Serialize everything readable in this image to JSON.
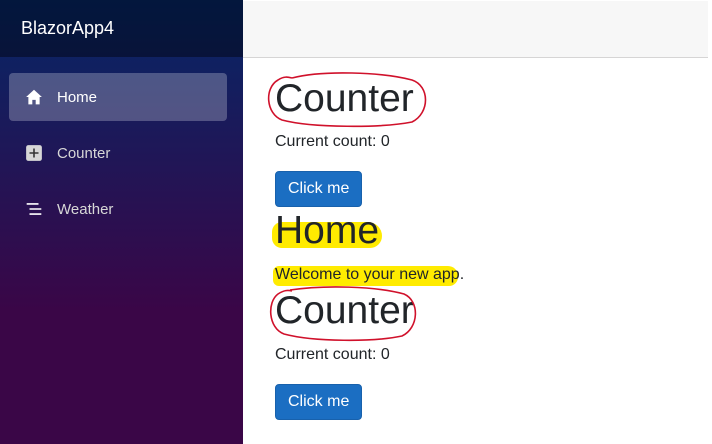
{
  "sidebar": {
    "brand": "BlazorApp4",
    "items": [
      {
        "label": "Home",
        "icon": "home-icon",
        "active": true
      },
      {
        "label": "Counter",
        "icon": "plus-square-icon",
        "active": false
      },
      {
        "label": "Weather",
        "icon": "list-icon",
        "active": false
      }
    ]
  },
  "main": {
    "counter1": {
      "title": "Counter",
      "count_text": "Current count: 0",
      "button": "Click me"
    },
    "home": {
      "title": "Home",
      "welcome": "Welcome to your new app."
    },
    "counter2": {
      "title": "Counter",
      "count_text": "Current count: 0",
      "button": "Click me"
    }
  },
  "colors": {
    "accent": "#1b6ec2",
    "sidebar_top": "#052767",
    "sidebar_bottom": "#3a0647",
    "annotation_circle": "#d0112b",
    "highlight": "#ffeb00"
  }
}
